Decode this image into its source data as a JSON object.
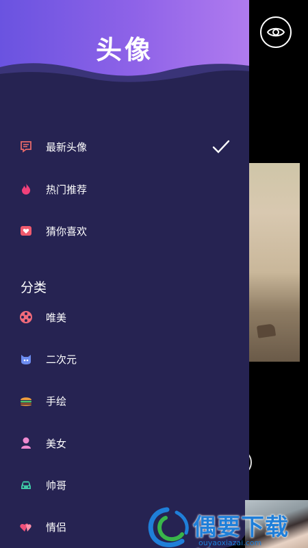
{
  "drawer": {
    "title": "头像",
    "menu": [
      {
        "label": "最新头像",
        "icon": "message-square-icon",
        "selected": true
      },
      {
        "label": "热门推荐",
        "icon": "flame-icon",
        "selected": false
      },
      {
        "label": "猜你喜欢",
        "icon": "heart-card-icon",
        "selected": false
      }
    ],
    "section_title": "分类",
    "categories": [
      {
        "label": "唯美",
        "icon": "film-reel-icon"
      },
      {
        "label": "二次元",
        "icon": "anime-cat-icon"
      },
      {
        "label": "手绘",
        "icon": "hamburger-icon"
      },
      {
        "label": "美女",
        "icon": "woman-icon"
      },
      {
        "label": "帅哥",
        "icon": "car-icon"
      },
      {
        "label": "情侣",
        "icon": "couple-hearts-icon"
      }
    ]
  },
  "background": {
    "eye_icon": "eye-icon"
  },
  "watermark": {
    "text": "偶要下载站",
    "url": "ouyaoxiazai.com"
  },
  "colors": {
    "drawer_bg": "#262352",
    "header_gradient_start": "#6a53e0",
    "header_gradient_end": "#b07bef"
  }
}
